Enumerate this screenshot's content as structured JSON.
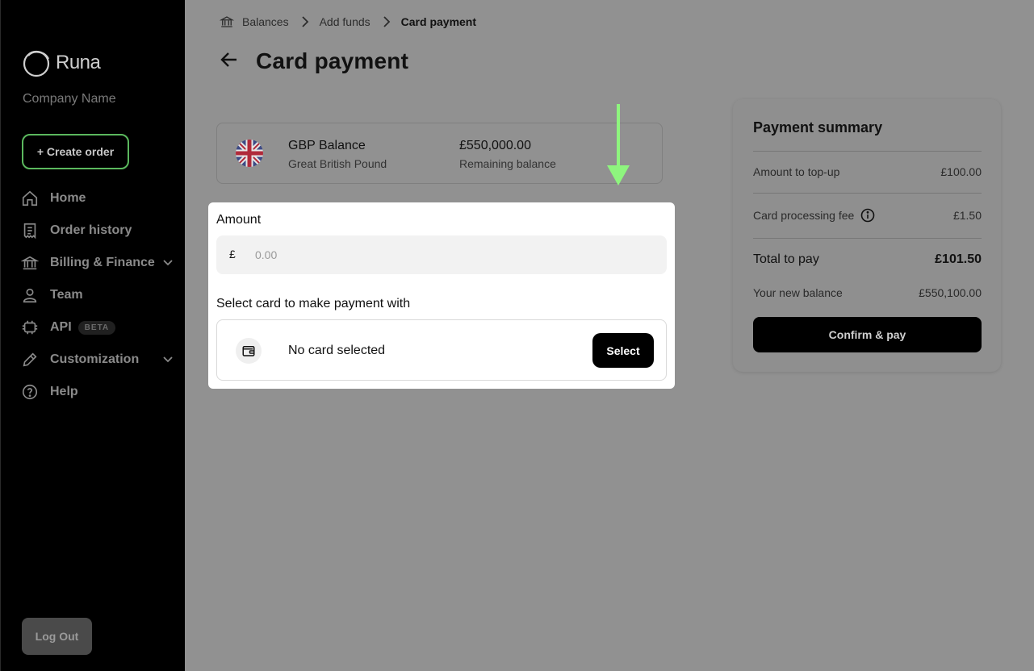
{
  "sidebar": {
    "logo_text": "Runa",
    "company": "Company Name",
    "create_order": "+ Create order",
    "items": [
      {
        "label": "Home",
        "icon": "home-icon"
      },
      {
        "label": "Order history",
        "icon": "receipt-icon"
      },
      {
        "label": "Billing & Finance",
        "icon": "bank-icon",
        "expandable": true
      },
      {
        "label": "Team",
        "icon": "person-icon"
      },
      {
        "label": "API",
        "icon": "api-icon",
        "badge": "BETA"
      },
      {
        "label": "Customization",
        "icon": "pencil-icon",
        "expandable": true
      },
      {
        "label": "Help",
        "icon": "help-icon"
      }
    ],
    "logout": "Log Out"
  },
  "breadcrumb": {
    "items": [
      "Balances",
      "Add funds"
    ],
    "current": "Card payment"
  },
  "page_title": "Card payment",
  "balance": {
    "name": "GBP Balance",
    "currency_name": "Great British Pound",
    "amount": "£550,000.00",
    "amount_label": "Remaining balance"
  },
  "amount_form": {
    "label": "Amount",
    "currency_symbol": "£",
    "placeholder": "0.00",
    "value": ""
  },
  "card_select": {
    "label": "Select card to make payment with",
    "status": "No card selected",
    "button": "Select"
  },
  "summary": {
    "title": "Payment summary",
    "topup_label": "Amount to top-up",
    "topup_value": "£100.00",
    "fee_label": "Card processing fee",
    "fee_value": "£1.50",
    "total_label": "Total to pay",
    "total_value": "£101.50",
    "new_balance_label": "Your new balance",
    "new_balance_value": "£550,100.00",
    "confirm": "Confirm & pay"
  },
  "colors": {
    "accent_green": "#5bb85e",
    "arrow_green": "#8ef57e"
  }
}
